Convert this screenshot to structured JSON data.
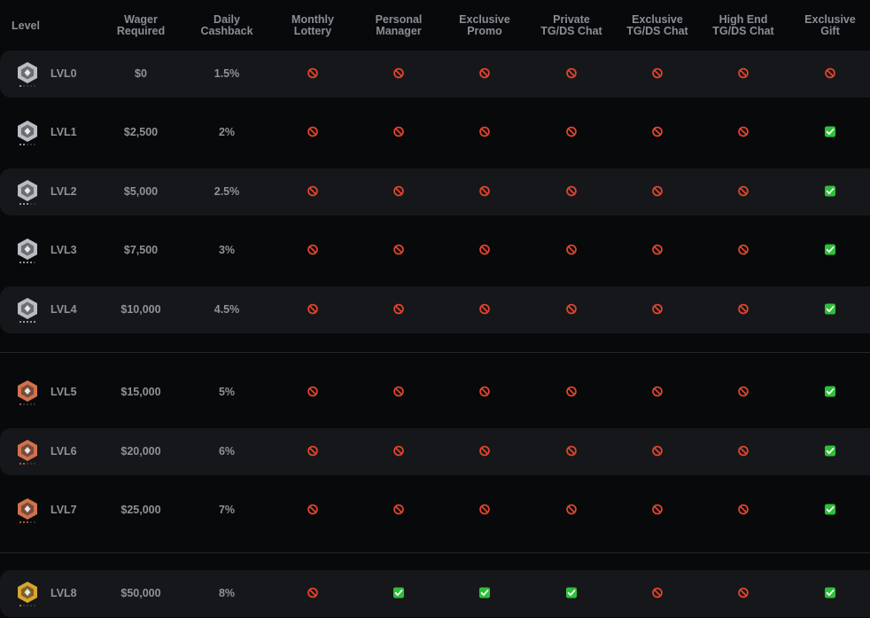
{
  "headers": [
    {
      "key": "level",
      "label": "Level"
    },
    {
      "key": "wager",
      "label": "Wager\nRequired"
    },
    {
      "key": "cashback",
      "label": "Daily\nCashback"
    },
    {
      "key": "lottery",
      "label": "Monthly\nLottery"
    },
    {
      "key": "manager",
      "label": "Personal\nManager"
    },
    {
      "key": "promo",
      "label": "Exclusive\nPromo"
    },
    {
      "key": "private_chat",
      "label": "Private\nTG/DS Chat"
    },
    {
      "key": "exclusive_chat",
      "label": "Exclusive\nTG/DS Chat"
    },
    {
      "key": "highend_chat",
      "label": "High End\nTG/DS Chat"
    },
    {
      "key": "gift",
      "label": "Exclusive\nGift"
    }
  ],
  "colors": {
    "silver": "#b9bcc2",
    "bronze": "#d2714c",
    "gold": "#d9a52b",
    "no": "#e2452b",
    "yes": "#2fbf3a"
  },
  "icons": {
    "no": "no-entry-icon",
    "yes": "check-mark-icon"
  },
  "rows": [
    {
      "level": "LVL0",
      "wager": "$0",
      "cashback": "1.5%",
      "tier": "silver",
      "benefits": [
        "no",
        "no",
        "no",
        "no",
        "no",
        "no",
        "no"
      ]
    },
    {
      "level": "LVL1",
      "wager": "$2,500",
      "cashback": "2%",
      "tier": "silver",
      "benefits": [
        "no",
        "no",
        "no",
        "no",
        "no",
        "no",
        "yes"
      ]
    },
    {
      "level": "LVL2",
      "wager": "$5,000",
      "cashback": "2.5%",
      "tier": "silver",
      "benefits": [
        "no",
        "no",
        "no",
        "no",
        "no",
        "no",
        "yes"
      ]
    },
    {
      "level": "LVL3",
      "wager": "$7,500",
      "cashback": "3%",
      "tier": "silver",
      "benefits": [
        "no",
        "no",
        "no",
        "no",
        "no",
        "no",
        "yes"
      ]
    },
    {
      "level": "LVL4",
      "wager": "$10,000",
      "cashback": "4.5%",
      "tier": "silver",
      "benefits": [
        "no",
        "no",
        "no",
        "no",
        "no",
        "no",
        "yes"
      ]
    },
    {
      "level": "LVL5",
      "wager": "$15,000",
      "cashback": "5%",
      "tier": "bronze",
      "benefits": [
        "no",
        "no",
        "no",
        "no",
        "no",
        "no",
        "yes"
      ]
    },
    {
      "level": "LVL6",
      "wager": "$20,000",
      "cashback": "6%",
      "tier": "bronze",
      "benefits": [
        "no",
        "no",
        "no",
        "no",
        "no",
        "no",
        "yes"
      ]
    },
    {
      "level": "LVL7",
      "wager": "$25,000",
      "cashback": "7%",
      "tier": "bronze",
      "benefits": [
        "no",
        "no",
        "no",
        "no",
        "no",
        "no",
        "yes"
      ]
    },
    {
      "level": "LVL8",
      "wager": "$50,000",
      "cashback": "8%",
      "tier": "gold",
      "benefits": [
        "no",
        "yes",
        "yes",
        "yes",
        "no",
        "no",
        "yes"
      ]
    }
  ]
}
